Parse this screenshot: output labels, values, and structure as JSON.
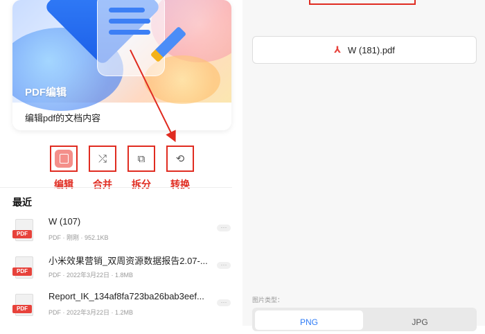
{
  "hero": {
    "title": "PDF编辑",
    "subtitle": "编辑pdf的文档内容"
  },
  "tools": [
    {
      "label": "编辑",
      "icon": "edit-icon"
    },
    {
      "label": "合并",
      "icon": "merge-icon"
    },
    {
      "label": "拆分",
      "icon": "split-icon"
    },
    {
      "label": "转换",
      "icon": "convert-icon"
    }
  ],
  "recent": {
    "title": "最近",
    "items": [
      {
        "name": "W (107)",
        "meta": "PDF · 刚刚 · 952.1KB"
      },
      {
        "name": "小米效果营销_双周资源数据报告2.07-...",
        "meta": "PDF · 2022年3月22日 · 1.8MB"
      },
      {
        "name": "Report_IK_134af8fa723ba26bab3eef...",
        "meta": "PDF · 2022年3月22日 · 1.2MB"
      }
    ],
    "more_label": "···",
    "file_tag": "PDF"
  },
  "right": {
    "selected_file": "W (181).pdf",
    "image_type_label": "图片类型：",
    "formats": [
      "PNG",
      "JPG"
    ],
    "selected_format": "PNG"
  },
  "colors": {
    "annotation_red": "#e02b20",
    "accent_blue": "#2f7cf6",
    "pdf_red": "#e7423b"
  }
}
